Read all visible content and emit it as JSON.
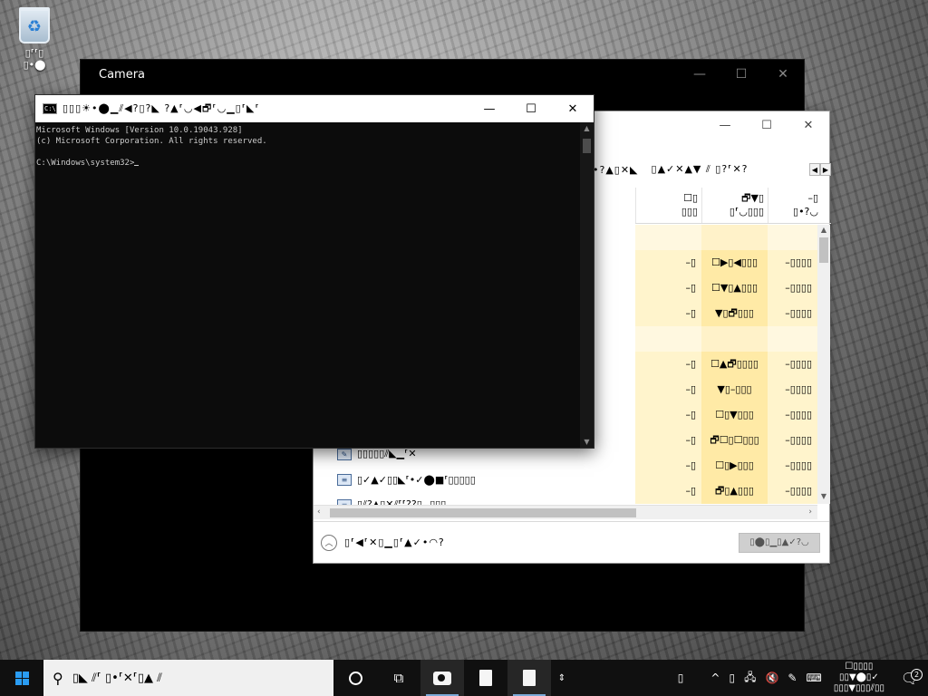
{
  "desktop": {
    "recycle_bin_label_1": "▯⸢⸢▯",
    "recycle_bin_label_2": "▯•⬤"
  },
  "camera_window": {
    "title": "Camera",
    "minimize": "—",
    "maximize": "☐",
    "close": "✕"
  },
  "list_window": {
    "minimize": "—",
    "maximize": "☐",
    "close": "✕",
    "toolbar_group_1": "•?▲▯✕◣",
    "toolbar_group_2": "▯▲✓✕▲▼ ⫽ ▯?⸢✕?",
    "scroll_left": "◀",
    "scroll_right": "▶",
    "columns": [
      {
        "top": "☐▯",
        "bottom": "▯▯▯"
      },
      {
        "top": "🗗▼▯",
        "bottom": "▯⸢◡▯▯▯"
      },
      {
        "top": "–▯",
        "bottom": "▯•?◡"
      }
    ],
    "rows": [
      {
        "blank": true,
        "c1": "",
        "c2": "",
        "c3": ""
      },
      {
        "c1": "–▯",
        "c2": "☐▶▯◀▯▯▯",
        "c3": "–▯▯▯▯"
      },
      {
        "c1": "–▯",
        "c2": "☐▼▯▲▯▯▯",
        "c3": "–▯▯▯▯"
      },
      {
        "c1": "–▯",
        "c2": "▼▯🗗▯▯▯",
        "c3": "–▯▯▯▯"
      },
      {
        "blank": true,
        "c1": "",
        "c2": "",
        "c3": ""
      },
      {
        "c1": "–▯",
        "c2": "☐▲🗗▯▯▯▯",
        "c3": "–▯▯▯▯"
      },
      {
        "c1": "–▯",
        "c2": "▼▯–▯▯▯",
        "c3": "–▯▯▯▯"
      },
      {
        "c1": "–▯",
        "c2": "☐▯▼▯▯▯",
        "c3": "–▯▯▯▯"
      },
      {
        "c1": "–▯",
        "c2": "🗗☐▯☐▯▯▯",
        "c3": "–▯▯▯▯"
      },
      {
        "c1": "–▯",
        "c2": "☐▯▶▯▯▯",
        "c3": "–▯▯▯▯"
      },
      {
        "c1": "–▯",
        "c2": "🗗▯▲▯▯▯",
        "c3": "–▯▯▯▯"
      }
    ],
    "left_items": [
      {
        "text": "▯▯▯▯▯⫽◣▁⸢✕"
      },
      {
        "text": "▯✓▲✓▯▯◣⸢•✓⬤■⸢▯▯▯▯▯"
      },
      {
        "text": "▯⫽?▲▯✕⫽⸢⸢??▯▁▯▯▯"
      }
    ],
    "footer_text": "▯⸢◀⸢✕▯▁▯⸢▲✓•◠?",
    "footer_button": "▯⬤▯▁▯▲✓?◡"
  },
  "cmd_window": {
    "title": "▯▯▯☀•⬤▁⫽◀?▯?◣ ?▲⸢◡◀🗗⸢◡▁▯⸢◣⸢",
    "icon_text": "C:\\",
    "minimize": "—",
    "maximize": "☐",
    "close": "✕",
    "line1": "Microsoft Windows [Version 10.0.19043.928]",
    "line2": "(c) Microsoft Corporation. All rights reserved.",
    "prompt": "C:\\Windows\\system32>"
  },
  "taskbar": {
    "search_placeholder": "▯◣ ⫽⸢ ▯•⸢✕⸢▯▲ ⫽",
    "tray_chevron": "^",
    "tray_items": [
      "▯",
      "▯",
      "🖧",
      "🔇",
      "✎",
      "⌨"
    ],
    "clock_line1": "☐▯▯▯▯",
    "clock_line2": "▯▯▼⬤▯✓",
    "clock_line3": "▯▯▯▼▯▯▯⫽▯▯",
    "notification_count": "2",
    "ime": "▯"
  }
}
